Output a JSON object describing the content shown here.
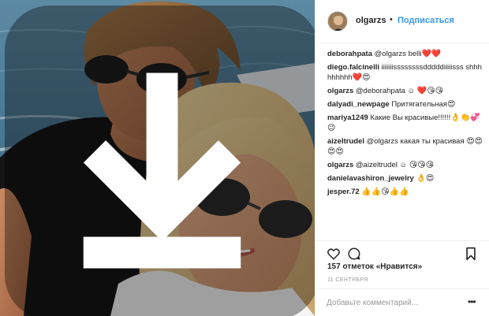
{
  "post": {
    "author": "olgarzs",
    "separator": "•",
    "follow_label": "Подписаться",
    "likes_text": "157 отметок «Нравится»",
    "date_text": "11 СЕНТЯБРЯ",
    "comment_placeholder": "Добавьте комментарий...",
    "more_label": "•••"
  },
  "comments": [
    {
      "user": "deborahpata",
      "mention": "@olgarzs",
      "text": " belli",
      "emoji": "❤️❤️"
    },
    {
      "user": "diego.falcinelli",
      "mention": "",
      "text": "iiiiiiissssssssdddddiiiiisss shhhhhhhhh",
      "emoji": "❤️😍"
    },
    {
      "user": "olgarzs",
      "mention": "@deborahpata",
      "text": " ☺ ",
      "emoji": "❤️😘😘"
    },
    {
      "user": "dalyadi_newpage",
      "mention": "",
      "text": "Притягательная",
      "emoji": "😍"
    },
    {
      "user": "mariya1249",
      "mention": "",
      "text": "Какие Вы красивые!!!!!!",
      "emoji": "👌👏💞😉"
    },
    {
      "user": "aizeltrudel",
      "mention": "@olgarzs",
      "text": " какая ты красивая ",
      "emoji": "😍😍😍😍"
    },
    {
      "user": "olgarzs",
      "mention": "@aizeltrudel",
      "text": " ☺ ",
      "emoji": "😘😘😘"
    },
    {
      "user": "danielavashiron_jewelry",
      "mention": "",
      "text": " ",
      "emoji": "👌😍"
    },
    {
      "user": "jesper.72",
      "mention": "",
      "text": " ",
      "emoji": "👍👍😘👍👍"
    }
  ],
  "colors": {
    "link_blue": "#3897f0",
    "text": "#262626",
    "muted": "#999999",
    "border": "#efefef"
  },
  "icons": [
    "download-icon",
    "heart-icon",
    "comment-icon",
    "bookmark-icon",
    "more-options-icon"
  ]
}
